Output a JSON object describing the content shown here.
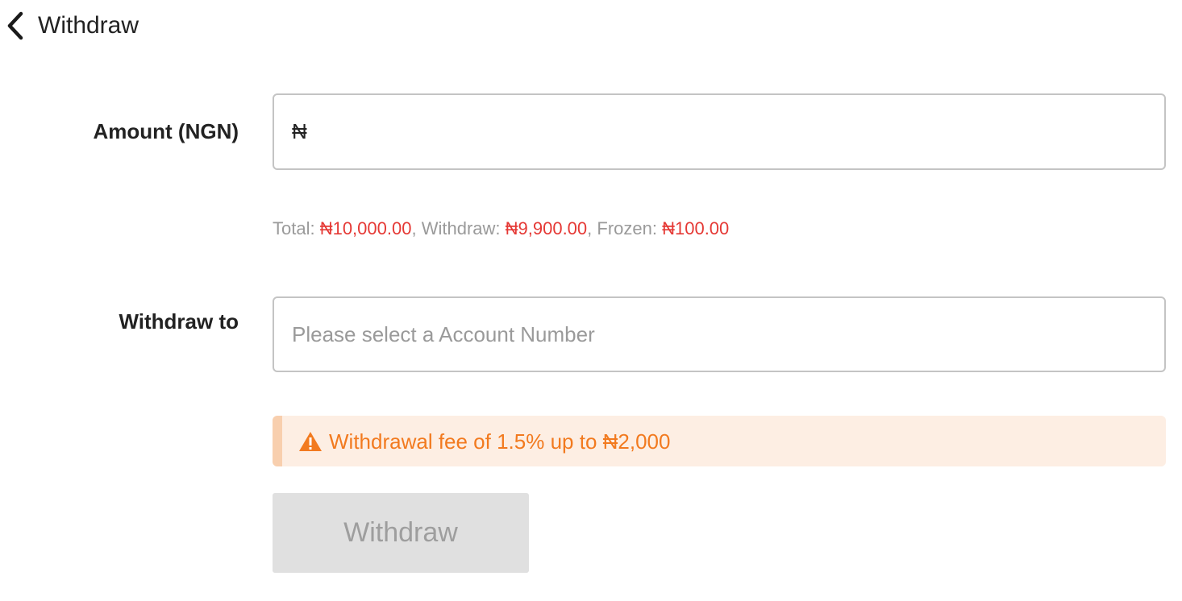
{
  "header": {
    "title": "Withdraw"
  },
  "form": {
    "amount": {
      "label": "Amount (NGN)",
      "prefix": "₦",
      "value": ""
    },
    "balances": {
      "total_label": "Total: ",
      "total_value": "₦10,000.00",
      "sep1": ", ",
      "withdraw_label": "Withdraw: ",
      "withdraw_value": "₦9,900.00",
      "sep2": ", ",
      "frozen_label": "Frozen: ",
      "frozen_value": "₦100.00"
    },
    "withdraw_to": {
      "label": "Withdraw to",
      "placeholder": "Please select a Account Number"
    },
    "notice": {
      "icon": "warning-icon",
      "text": "Withdrawal fee of 1.5% up to ₦2,000"
    },
    "submit": {
      "label": "Withdraw",
      "disabled": true
    }
  },
  "colors": {
    "accent_red": "#e53935",
    "notice_text": "#f27a1f",
    "notice_bg": "#fdeee3"
  }
}
